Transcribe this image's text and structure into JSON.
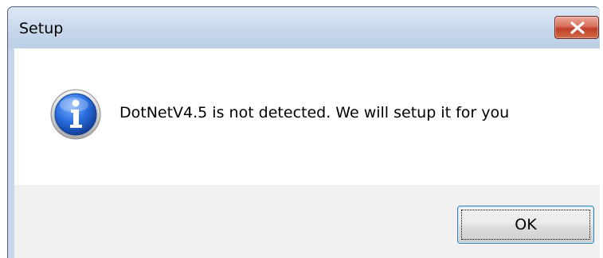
{
  "window": {
    "title": "Setup"
  },
  "icons": {
    "close": "close-icon",
    "info": "information-icon"
  },
  "dialog": {
    "message": "DotNetV4.5 is not detected. We will setup it for you",
    "ok_label": "OK"
  },
  "colors": {
    "close_button": "#c7432f",
    "info_icon": "#1f5fd6",
    "button_focus_border": "#3c7fb1"
  }
}
